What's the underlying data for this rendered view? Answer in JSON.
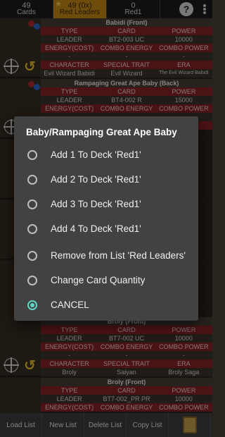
{
  "topbar": {
    "cards_count": "49",
    "cards_label": "Cards",
    "leaders_count": "49 (0x)",
    "leaders_label": "Red Leaders",
    "red1_count": "0",
    "red1_label": "Red1",
    "help_glyph": "?"
  },
  "cards": [
    {
      "name": "Babidi (Front)",
      "h1": [
        "TYPE",
        "CARD",
        "POWER"
      ],
      "v1": [
        "LEADER",
        "BT2-003 UC",
        "10000"
      ],
      "h2": [
        "ENERGY(COST)",
        "COMBO ENERGY",
        "COMBO POWER"
      ],
      "v2": [
        "-",
        "-",
        "-"
      ],
      "h3": [
        "CHARACTER",
        "SPECIAL TRAIT",
        "ERA"
      ],
      "v3": [
        "Evil Wizard Babidi",
        "Evil Wizard",
        "The Evil Wizard Babidi Saga"
      ]
    },
    {
      "name": "Rampaging Great Ape Baby (Back)",
      "h1": [
        "TYPE",
        "CARD",
        "POWER"
      ],
      "v1": [
        "LEADER",
        "BT4-002 R",
        "15000"
      ],
      "h2": [
        "ENERGY(COST)",
        "COMBO ENERGY",
        "COMBO POWER"
      ],
      "v2": [
        "",
        "",
        ""
      ],
      "h3": [
        "",
        "",
        ""
      ],
      "v3": [
        "",
        "",
        ""
      ]
    },
    {
      "name": "Broly (Front)",
      "h1": [
        "TYPE",
        "CARD",
        "POWER"
      ],
      "v1": [
        "LEADER",
        "BT7-002 UC",
        "10000"
      ],
      "h2": [
        "ENERGY(COST)",
        "COMBO ENERGY",
        "COMBO POWER"
      ],
      "v2": [
        "-",
        "-",
        "-"
      ],
      "h3": [
        "CHARACTER",
        "SPECIAL TRAIT",
        "ERA"
      ],
      "v3": [
        "Broly",
        "Saiyan",
        "Broly Saga"
      ]
    },
    {
      "name": "Broly (Front)",
      "h1": [
        "TYPE",
        "CARD",
        "POWER"
      ],
      "v1": [
        "LEADER",
        "BT7-002_PR PR",
        "10000"
      ],
      "h2": [
        "ENERGY(COST)",
        "COMBO ENERGY",
        "COMBO POWER"
      ],
      "v2": [
        "",
        "",
        ""
      ],
      "h3": [
        "",
        "",
        ""
      ],
      "v3": [
        "",
        "",
        ""
      ]
    }
  ],
  "bottombar": {
    "load": "Load List",
    "new": "New List",
    "delete": "Delete List",
    "copy": "Copy List"
  },
  "dialog": {
    "title": "Baby/Rampaging Great Ape Baby",
    "options": [
      {
        "label": "Add 1 To Deck 'Red1'",
        "selected": false
      },
      {
        "label": "Add 2 To Deck 'Red1'",
        "selected": false
      },
      {
        "label": "Add 3 To Deck 'Red1'",
        "selected": false
      },
      {
        "label": "Add 4 To Deck 'Red1'",
        "selected": false
      },
      {
        "label": "Remove from List 'Red Leaders'",
        "selected": false
      },
      {
        "label": "Change Card Quantity",
        "selected": false
      },
      {
        "label": "CANCEL",
        "selected": true
      }
    ]
  },
  "colors": {
    "accent": "#5ed6c6",
    "tab_active": "#c98a17",
    "header_red": "#8a2329"
  }
}
